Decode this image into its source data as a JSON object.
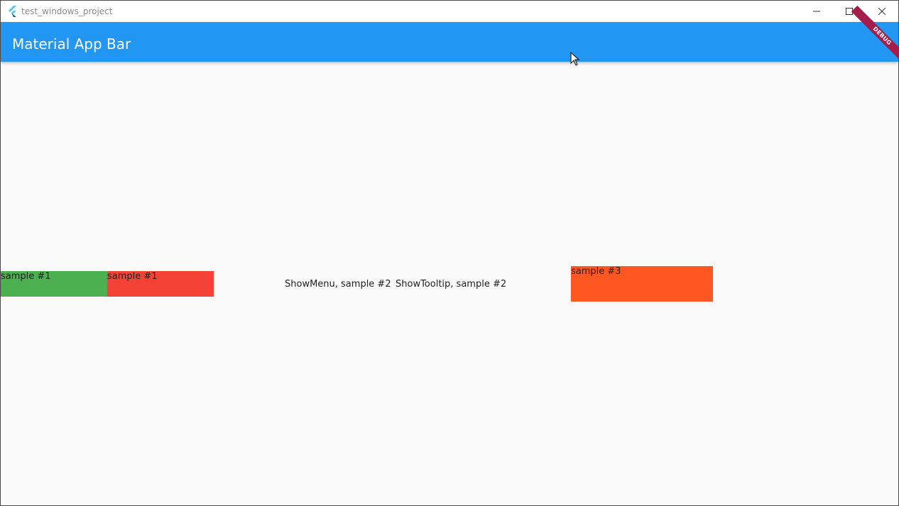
{
  "window": {
    "title": "test_windows_project",
    "controls": {
      "minimize": "minimize-icon",
      "maximize": "maximize-icon",
      "close": "close-icon"
    }
  },
  "appbar": {
    "title": "Material App Bar",
    "color": "#2196f3",
    "debug_label": "DEBUG"
  },
  "main": {
    "sample1_green": {
      "label": "sample #1",
      "color": "#4caf50"
    },
    "sample1_red": {
      "label": "sample #1",
      "color": "#f44336"
    },
    "show_menu": "ShowMenu, sample #2",
    "show_tooltip": "ShowTooltip, sample #2",
    "sample3": {
      "label": "sample #3",
      "color": "#ff5722"
    }
  }
}
